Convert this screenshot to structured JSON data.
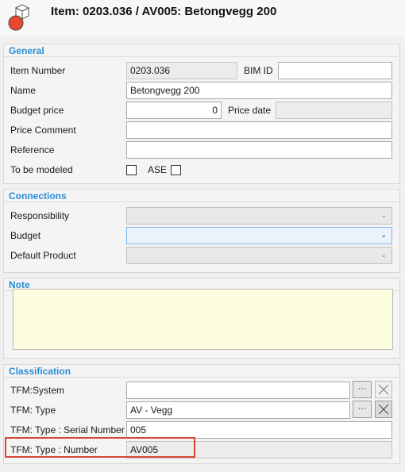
{
  "header": {
    "title": "Item: 0203.036 / AV005: Betongvegg 200"
  },
  "general": {
    "title": "General",
    "item_number_label": "Item Number",
    "item_number_value": "0203.036",
    "bim_id_label": "BIM ID",
    "bim_id_value": "",
    "name_label": "Name",
    "name_value": "Betongvegg 200",
    "budget_price_label": "Budget price",
    "budget_price_value": "0",
    "price_date_label": "Price date",
    "price_date_value": "",
    "price_comment_label": "Price Comment",
    "price_comment_value": "",
    "reference_label": "Reference",
    "reference_value": "",
    "to_be_modeled_label": "To be modeled",
    "ase_label": "ASE"
  },
  "connections": {
    "title": "Connections",
    "responsibility_label": "Responsibility",
    "budget_label": "Budget",
    "default_product_label": "Default Product"
  },
  "note": {
    "title": "Note",
    "value": ""
  },
  "classification": {
    "title": "Classification",
    "tfm_system_label": "TFM:System",
    "tfm_system_value": "",
    "tfm_type_label": "TFM: Type",
    "tfm_type_value": "AV - Vegg",
    "tfm_serial_label": "TFM: Type : Serial Number",
    "tfm_serial_value": "005",
    "tfm_number_label": "TFM: Type : Number",
    "tfm_number_value": "AV005"
  }
}
